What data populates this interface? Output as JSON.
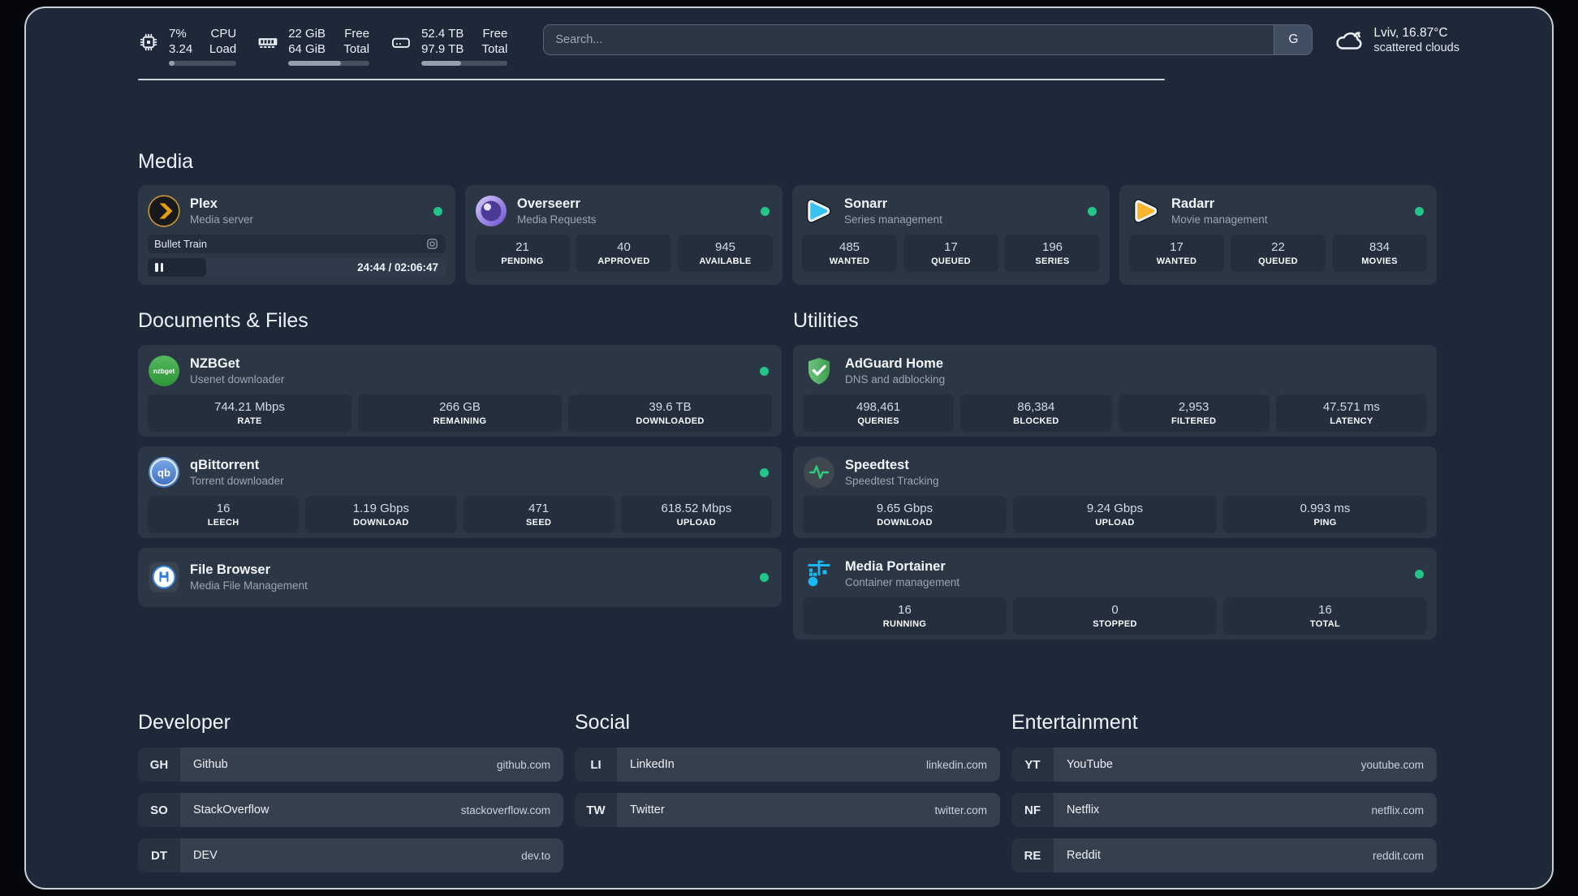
{
  "topbar": {
    "stats": [
      {
        "icon": "cpu-icon",
        "value_top": "7%",
        "value_bottom": "3.24",
        "label_top": "CPU",
        "label_bottom": "Load",
        "progress_pct": 8
      },
      {
        "icon": "ram-icon",
        "value_top": "22 GiB",
        "value_bottom": "64 GiB",
        "label_top": "Free",
        "label_bottom": "Total",
        "progress_pct": 65
      },
      {
        "icon": "disk-icon",
        "value_top": "52.4 TB",
        "value_bottom": "97.9 TB",
        "label_top": "Free",
        "label_bottom": "Total",
        "progress_pct": 46
      }
    ],
    "search": {
      "placeholder": "Search...",
      "engine_button_label": "G"
    },
    "weather": {
      "location": "Lviv, 16.87°C",
      "condition": "scattered clouds"
    }
  },
  "sections": {
    "media": {
      "title": "Media",
      "plex": {
        "name": "Plex",
        "description": "Media server",
        "status": "online",
        "now_playing": {
          "title": "Bullet Train",
          "state": "paused",
          "time_display": "24:44 / 02:06:47",
          "progress_pct": 19.5
        }
      },
      "overseerr": {
        "name": "Overseerr",
        "description": "Media Requests",
        "status": "online",
        "stats": [
          {
            "value": "21",
            "label": "PENDING"
          },
          {
            "value": "40",
            "label": "APPROVED"
          },
          {
            "value": "945",
            "label": "AVAILABLE"
          }
        ]
      },
      "sonarr": {
        "name": "Sonarr",
        "description": "Series management",
        "status": "online",
        "stats": [
          {
            "value": "485",
            "label": "WANTED"
          },
          {
            "value": "17",
            "label": "QUEUED"
          },
          {
            "value": "196",
            "label": "SERIES"
          }
        ]
      },
      "radarr": {
        "name": "Radarr",
        "description": "Movie management",
        "status": "online",
        "stats": [
          {
            "value": "17",
            "label": "WANTED"
          },
          {
            "value": "22",
            "label": "QUEUED"
          },
          {
            "value": "834",
            "label": "MOVIES"
          }
        ]
      }
    },
    "documents": {
      "title": "Documents & Files",
      "nzbget": {
        "name": "NZBGet",
        "description": "Usenet downloader",
        "status": "online",
        "stats": [
          {
            "value": "744.21 Mbps",
            "label": "RATE"
          },
          {
            "value": "266 GB",
            "label": "REMAINING"
          },
          {
            "value": "39.6 TB",
            "label": "DOWNLOADED"
          }
        ]
      },
      "qbittorrent": {
        "name": "qBittorrent",
        "description": "Torrent downloader",
        "status": "online",
        "stats": [
          {
            "value": "16",
            "label": "LEECH"
          },
          {
            "value": "1.19 Gbps",
            "label": "DOWNLOAD"
          },
          {
            "value": "471",
            "label": "SEED"
          },
          {
            "value": "618.52 Mbps",
            "label": "UPLOAD"
          }
        ]
      },
      "filebrowser": {
        "name": "File Browser",
        "description": "Media File Management",
        "status": "online"
      }
    },
    "utilities": {
      "title": "Utilities",
      "adguard": {
        "name": "AdGuard Home",
        "description": "DNS and adblocking",
        "stats": [
          {
            "value": "498,461",
            "label": "QUERIES"
          },
          {
            "value": "86,384",
            "label": "BLOCKED"
          },
          {
            "value": "2,953",
            "label": "FILTERED"
          },
          {
            "value": "47.571 ms",
            "label": "LATENCY"
          }
        ]
      },
      "speedtest": {
        "name": "Speedtest",
        "description": "Speedtest Tracking",
        "stats": [
          {
            "value": "9.65 Gbps",
            "label": "DOWNLOAD"
          },
          {
            "value": "9.24 Gbps",
            "label": "UPLOAD"
          },
          {
            "value": "0.993 ms",
            "label": "PING"
          }
        ]
      },
      "portainer": {
        "name": "Media Portainer",
        "description": "Container management",
        "status": "online",
        "stats": [
          {
            "value": "16",
            "label": "RUNNING"
          },
          {
            "value": "0",
            "label": "STOPPED"
          },
          {
            "value": "16",
            "label": "TOTAL"
          }
        ]
      }
    },
    "bookmarks": [
      {
        "title": "Developer",
        "links": [
          {
            "abbr": "GH",
            "name": "Github",
            "url": "github.com"
          },
          {
            "abbr": "SO",
            "name": "StackOverflow",
            "url": "stackoverflow.com"
          },
          {
            "abbr": "DT",
            "name": "DEV",
            "url": "dev.to"
          }
        ]
      },
      {
        "title": "Social",
        "links": [
          {
            "abbr": "LI",
            "name": "LinkedIn",
            "url": "linkedin.com"
          },
          {
            "abbr": "TW",
            "name": "Twitter",
            "url": "twitter.com"
          }
        ]
      },
      {
        "title": "Entertainment",
        "links": [
          {
            "abbr": "YT",
            "name": "YouTube",
            "url": "youtube.com"
          },
          {
            "abbr": "NF",
            "name": "Netflix",
            "url": "netflix.com"
          },
          {
            "abbr": "RE",
            "name": "Reddit",
            "url": "reddit.com"
          }
        ]
      }
    ]
  },
  "colors": {
    "page_bg": "#1e2839",
    "card_bg": "#2c3746",
    "stat_box_bg": "#242e3d",
    "status_online": "#23c686",
    "plex_gold": "#e5a00d",
    "sonarr_cyan": "#36c3f1",
    "radarr_gold": "#f7b52c",
    "adguard_green": "#4fae5f",
    "qbittorrent_blue": "#3c6cc0",
    "nzbget_green": "#3aa246",
    "speedtest_green": "#27d17d",
    "portainer_cyan": "#18b9f2",
    "filebrowser_blue": "#2d7cd6",
    "divider": "#d0d6de"
  },
  "icons": {
    "cpu-icon": "processor chip outline",
    "ram-icon": "memory stick",
    "disk-icon": "hard drive",
    "cloud-icon": "cloud / scattered clouds",
    "pause-icon": "pause bars",
    "session-icon": "circle in rounded square",
    "search-engine-icon": "letter G"
  }
}
